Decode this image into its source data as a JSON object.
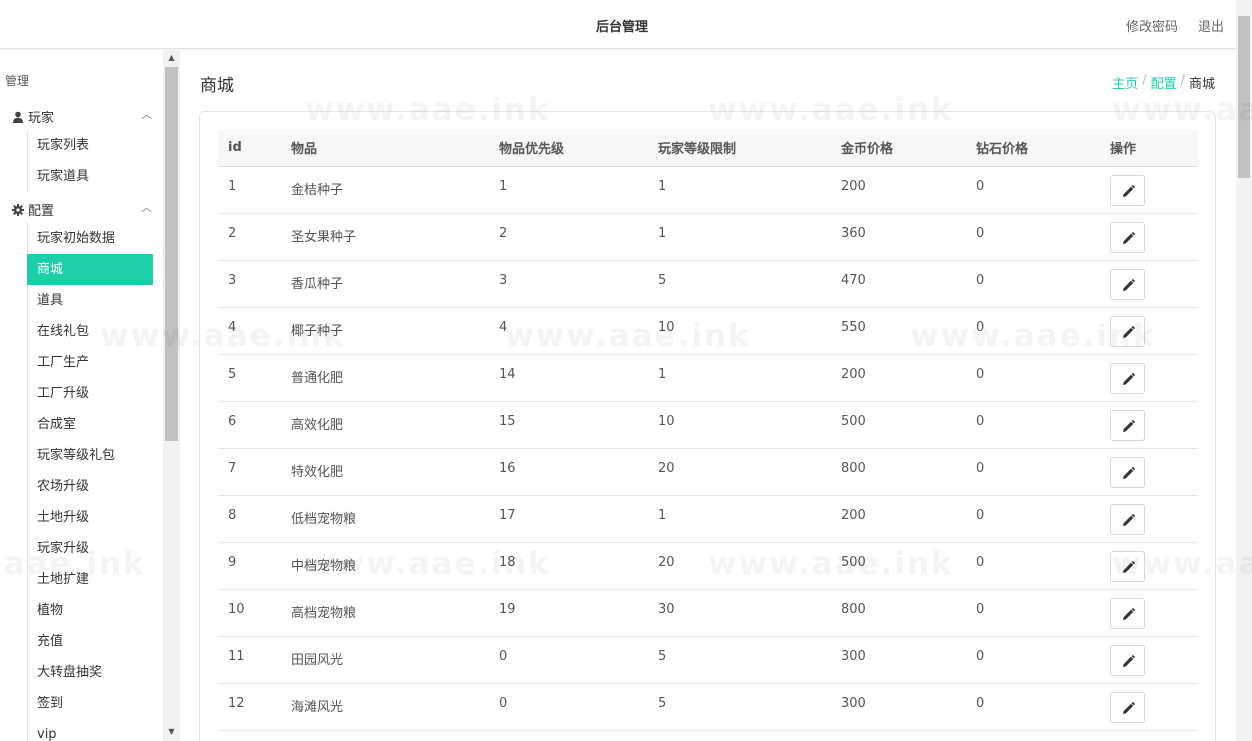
{
  "header": {
    "title": "后台管理",
    "change_password": "修改密码",
    "logout": "退出"
  },
  "sidebar": {
    "title": "管理",
    "groups": [
      {
        "label": "玩家",
        "icon": "user-icon",
        "items": [
          {
            "label": "玩家列表"
          },
          {
            "label": "玩家道具"
          }
        ]
      },
      {
        "label": "配置",
        "icon": "gear-icon",
        "items": [
          {
            "label": "玩家初始数据"
          },
          {
            "label": "商城"
          },
          {
            "label": "道具"
          },
          {
            "label": "在线礼包"
          },
          {
            "label": "工厂生产"
          },
          {
            "label": "工厂升级"
          },
          {
            "label": "合成室"
          },
          {
            "label": "玩家等级礼包"
          },
          {
            "label": "农场升级"
          },
          {
            "label": "土地升级"
          },
          {
            "label": "玩家升级"
          },
          {
            "label": "土地扩建"
          },
          {
            "label": "植物"
          },
          {
            "label": "充值"
          },
          {
            "label": "大转盘抽奖"
          },
          {
            "label": "签到"
          },
          {
            "label": "vip"
          }
        ]
      }
    ],
    "active_item": "商城"
  },
  "page": {
    "title": "商城",
    "breadcrumb": [
      "主页",
      "配置",
      "商城"
    ]
  },
  "table": {
    "columns": [
      "id",
      "物品",
      "物品优先级",
      "玩家等级限制",
      "金币价格",
      "钻石价格",
      "操作"
    ],
    "rows": [
      [
        "1",
        "金桔种子",
        "1",
        "1",
        "200",
        "0"
      ],
      [
        "2",
        "圣女果种子",
        "2",
        "1",
        "360",
        "0"
      ],
      [
        "3",
        "香瓜种子",
        "3",
        "5",
        "470",
        "0"
      ],
      [
        "4",
        "椰子种子",
        "4",
        "10",
        "550",
        "0"
      ],
      [
        "5",
        "普通化肥",
        "14",
        "1",
        "200",
        "0"
      ],
      [
        "6",
        "高效化肥",
        "15",
        "10",
        "500",
        "0"
      ],
      [
        "7",
        "特效化肥",
        "16",
        "20",
        "800",
        "0"
      ],
      [
        "8",
        "低档宠物粮",
        "17",
        "1",
        "200",
        "0"
      ],
      [
        "9",
        "中档宠物粮",
        "18",
        "20",
        "500",
        "0"
      ],
      [
        "10",
        "高档宠物粮",
        "19",
        "30",
        "800",
        "0"
      ],
      [
        "11",
        "田园风光",
        "0",
        "5",
        "300",
        "0"
      ],
      [
        "12",
        "海滩风光",
        "0",
        "5",
        "300",
        "0"
      ]
    ]
  },
  "watermark": "www.aae.ink",
  "colors": {
    "accent": "#1ccfa8"
  }
}
